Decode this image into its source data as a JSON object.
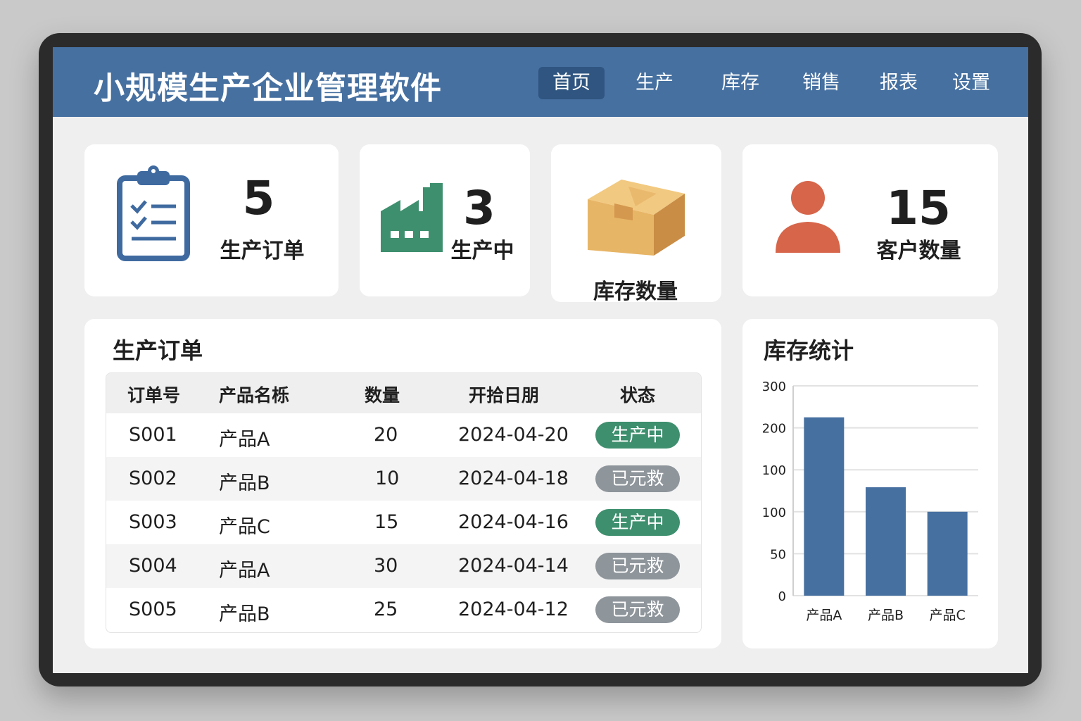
{
  "app": {
    "title": "小规模生产企业管理软件"
  },
  "nav": [
    {
      "label": "首页",
      "active": true
    },
    {
      "label": "生产",
      "active": false
    },
    {
      "label": "库存",
      "active": false
    },
    {
      "label": "销售",
      "active": false
    },
    {
      "label": "报表",
      "active": false
    },
    {
      "label": "设置",
      "active": false
    }
  ],
  "stats": {
    "orders": {
      "value": "5",
      "label": "生产订单",
      "icon": "clipboard-icon"
    },
    "in_production": {
      "value": "3",
      "label": "生产中",
      "icon": "factory-icon"
    },
    "inventory": {
      "value": "",
      "label": "库存数量",
      "icon": "box-icon"
    },
    "customers": {
      "value": "15",
      "label": "客户数量",
      "icon": "user-icon"
    }
  },
  "orders_panel": {
    "title": "生产订单",
    "columns": [
      "订单号",
      "产品名栎",
      "数量",
      "开拾日朋",
      "状态"
    ],
    "rows": [
      {
        "id": "S001",
        "product": "产品A",
        "qty": "20",
        "date": "2024-04-20",
        "status": "生产中",
        "status_type": "green"
      },
      {
        "id": "S002",
        "product": "产品B",
        "qty": "10",
        "date": "2024-04-18",
        "status": "已元救",
        "status_type": "gray"
      },
      {
        "id": "S003",
        "product": "产品C",
        "qty": "15",
        "date": "2024-04-16",
        "status": "生产中",
        "status_type": "green"
      },
      {
        "id": "S004",
        "product": "产品A",
        "qty": "30",
        "date": "2024-04-14",
        "status": "已元救",
        "status_type": "gray"
      },
      {
        "id": "S005",
        "product": "产品B",
        "qty": "25",
        "date": "2024-04-12",
        "status": "已元救",
        "status_type": "gray"
      }
    ]
  },
  "inventory_panel": {
    "title": "库存统计"
  },
  "chart_data": {
    "type": "bar",
    "categories": [
      "产品A",
      "产品B",
      "产品C"
    ],
    "values": [
      255,
      155,
      120
    ],
    "ytick_labels": [
      "0",
      "50",
      "100",
      "100",
      "200",
      "300"
    ],
    "ylim": [
      0,
      300
    ],
    "grid": true,
    "bar_color": "#4670a0"
  },
  "colors": {
    "header": "#4670a0",
    "active_nav": "#2f5580",
    "badge_green": "#3e8f6e",
    "badge_gray": "#8e959b",
    "icon_blue": "#3f6aa0",
    "icon_green": "#3e8f6e",
    "icon_orange": "#d6654a",
    "box_tan": "#e7b566"
  }
}
